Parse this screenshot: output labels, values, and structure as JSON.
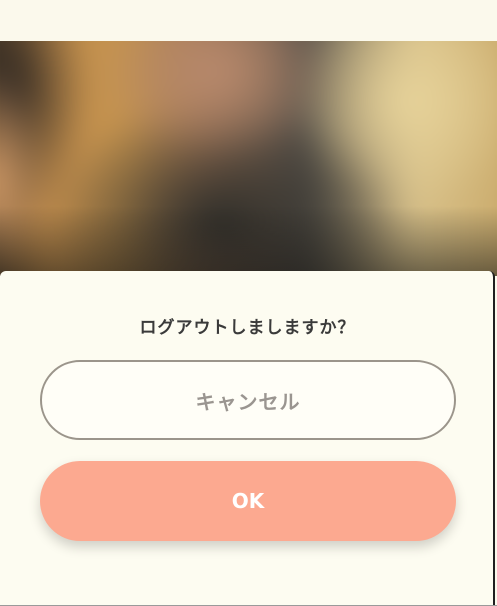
{
  "dialog": {
    "title": "ログアウトしましますか？",
    "cancel_label": "キャンセル",
    "ok_label": "OK"
  },
  "colors": {
    "background": "#fbf9ec",
    "sheet": "#fdfcf1",
    "ok_button": "#fca990",
    "cancel_border": "#9b958b",
    "title_text": "#3a3a3a"
  }
}
